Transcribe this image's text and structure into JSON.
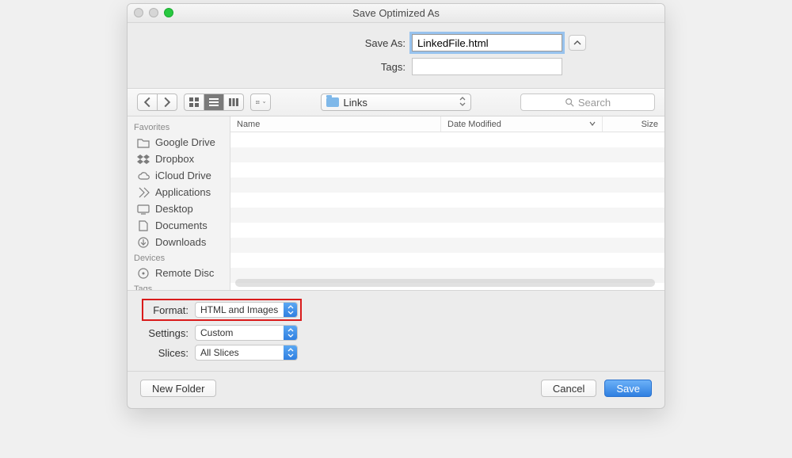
{
  "window": {
    "title": "Save Optimized As"
  },
  "fields": {
    "save_as_label": "Save As:",
    "save_as_value": "LinkedFile.html",
    "tags_label": "Tags:"
  },
  "toolbar": {
    "folder_name": "Links",
    "search_placeholder": "Search"
  },
  "columns": {
    "name": "Name",
    "date": "Date Modified",
    "size": "Size"
  },
  "sidebar": {
    "favorites_header": "Favorites",
    "favorites": [
      {
        "label": "Google Drive",
        "icon": "folder"
      },
      {
        "label": "Dropbox",
        "icon": "dropbox"
      },
      {
        "label": "iCloud Drive",
        "icon": "cloud"
      },
      {
        "label": "Applications",
        "icon": "apps"
      },
      {
        "label": "Desktop",
        "icon": "desktop"
      },
      {
        "label": "Documents",
        "icon": "doc"
      },
      {
        "label": "Downloads",
        "icon": "download"
      }
    ],
    "devices_header": "Devices",
    "devices": [
      {
        "label": "Remote Disc",
        "icon": "disc"
      }
    ],
    "tags_header": "Tags"
  },
  "options": {
    "format_label": "Format:",
    "format_value": "HTML and Images",
    "settings_label": "Settings:",
    "settings_value": "Custom",
    "slices_label": "Slices:",
    "slices_value": "All Slices"
  },
  "actions": {
    "new_folder": "New Folder",
    "cancel": "Cancel",
    "save": "Save"
  }
}
